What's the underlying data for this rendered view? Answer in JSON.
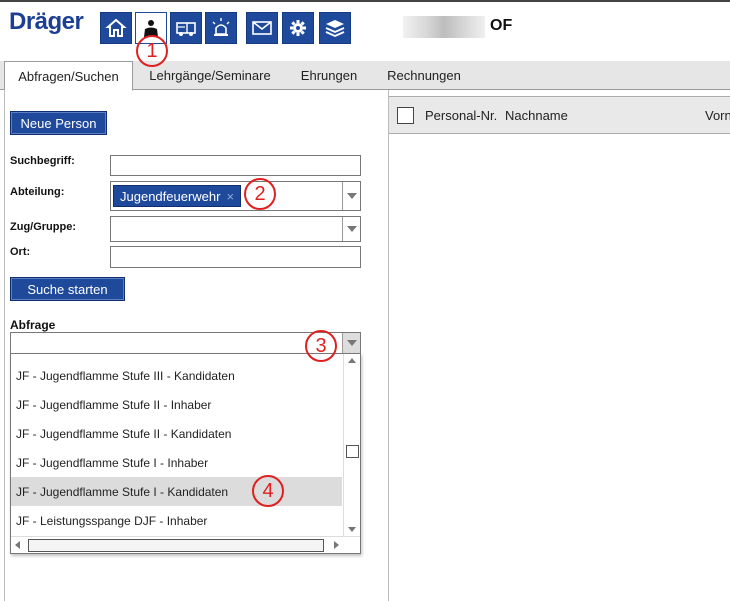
{
  "brand": {
    "logo_text": "Dräger"
  },
  "nav": {
    "buttons": [
      {
        "name": "home-icon",
        "active": false
      },
      {
        "name": "person-icon",
        "active": true
      },
      {
        "name": "vehicle-icon",
        "active": false
      },
      {
        "name": "alarm-light-icon",
        "active": false
      },
      {
        "name": "mail-icon",
        "active": false
      },
      {
        "name": "gear-icon",
        "active": false
      },
      {
        "name": "layers-icon",
        "active": false
      }
    ]
  },
  "header": {
    "org_suffix": "OF"
  },
  "markers": [
    "1",
    "2",
    "3",
    "4"
  ],
  "tabs": [
    {
      "label": "Abfragen/Suchen",
      "active": true
    },
    {
      "label": "Lehrgänge/Seminare",
      "active": false
    },
    {
      "label": "Ehrungen",
      "active": false
    },
    {
      "label": "Rechnungen",
      "active": false
    }
  ],
  "form": {
    "new_person_label": "Neue Person",
    "search_term_label": "Suchbegriff:",
    "search_term_value": "",
    "department_label": "Abteilung:",
    "department_tag": "Jugendfeuerwehr",
    "department_tag_remove": "×",
    "group_label": "Zug/Gruppe:",
    "place_label": "Ort:",
    "place_value": "",
    "start_search_label": "Suche starten",
    "query_label": "Abfrage",
    "query_value": ""
  },
  "dropdown": {
    "options": [
      {
        "label": "JF - Jugendflamme Stufe III - Kandidaten",
        "highlighted": false
      },
      {
        "label": "JF - Jugendflamme Stufe II - Inhaber",
        "highlighted": false
      },
      {
        "label": "JF - Jugendflamme Stufe II - Kandidaten",
        "highlighted": false
      },
      {
        "label": "JF - Jugendflamme Stufe I - Inhaber",
        "highlighted": false
      },
      {
        "label": "JF - Jugendflamme Stufe I - Kandidaten",
        "highlighted": true
      },
      {
        "label": "JF - Leistungsspange DJF - Inhaber",
        "highlighted": false
      }
    ]
  },
  "grid": {
    "columns": [
      "Personal-Nr.",
      "Nachname",
      "Vorn"
    ]
  },
  "colors": {
    "accent": "#1f4a9c",
    "marker": "#e02020",
    "highlight": "#dcdcdc"
  }
}
